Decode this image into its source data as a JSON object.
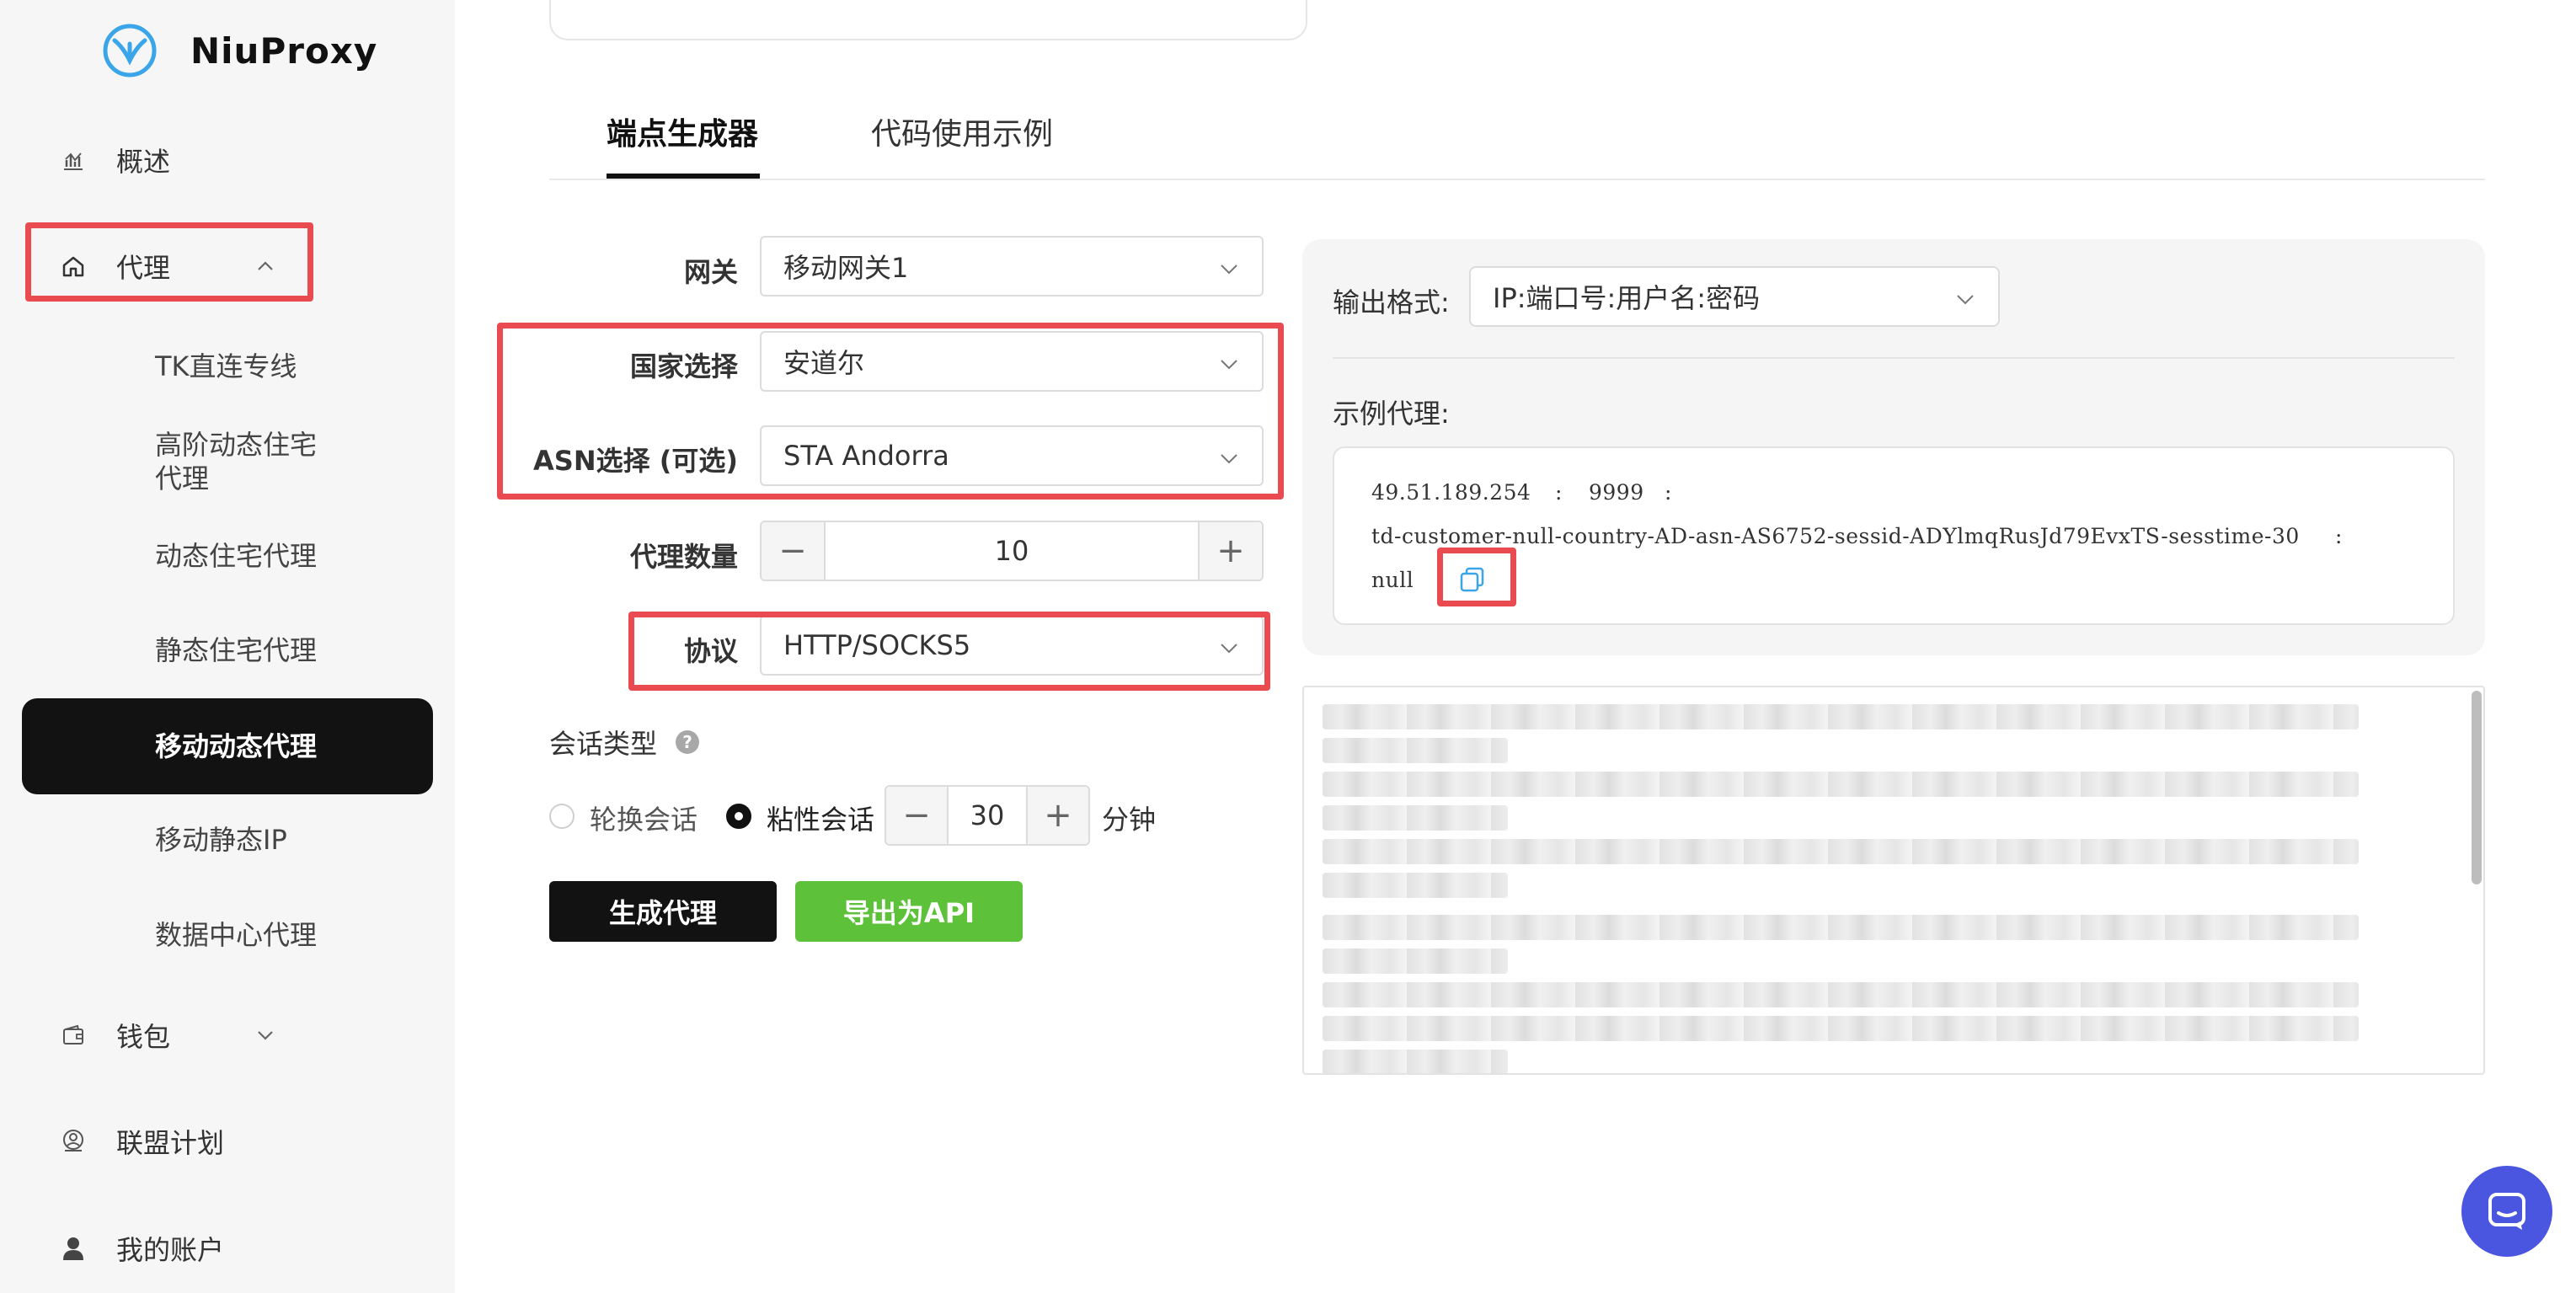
{
  "brand": {
    "name": "NiuProxy"
  },
  "sidebar": {
    "top_items": [
      {
        "label": "概述",
        "icon": "chart-icon"
      },
      {
        "label": "代理",
        "icon": "home-icon"
      },
      {
        "label": "钱包",
        "icon": "wallet-icon"
      },
      {
        "label": "联盟计划",
        "icon": "affiliate-icon"
      },
      {
        "label": "我的账户",
        "icon": "user-icon"
      }
    ],
    "sub_items": [
      {
        "label": "TK直连专线"
      },
      {
        "label": "高阶动态住宅\n代理"
      },
      {
        "label": "动态住宅代理"
      },
      {
        "label": "静态住宅代理"
      },
      {
        "label": "移动动态代理",
        "active": true
      },
      {
        "label": "移动静态IP"
      },
      {
        "label": "数据中心代理"
      }
    ]
  },
  "tabs": [
    {
      "label": "端点生成器",
      "active": true
    },
    {
      "label": "代码使用示例",
      "active": false
    }
  ],
  "form": {
    "gateway": {
      "label": "网关",
      "value": "移动网关1"
    },
    "country": {
      "label": "国家选择",
      "value": "安道尔"
    },
    "asn": {
      "label": "ASN选择 (可选)",
      "value": "STA Andorra"
    },
    "quantity": {
      "label": "代理数量",
      "value": "10",
      "minus": "−",
      "plus": "+"
    },
    "protocol": {
      "label": "协议",
      "value": "HTTP/SOCKS5"
    }
  },
  "session": {
    "title": "会话类型",
    "help": "?",
    "rotating_label": "轮换会话",
    "sticky_label": "粘性会话",
    "selected": "sticky",
    "duration": "30",
    "minus": "−",
    "plus": "+",
    "unit": "分钟"
  },
  "buttons": {
    "generate": "生成代理",
    "export_api": "导出为API"
  },
  "output": {
    "format_label": "输出格式:",
    "format_value": "IP:端口号:用户名:密码",
    "example_label": "示例代理:",
    "example_ip": "49.51.189.254",
    "example_sep": ":",
    "example_port": "9999",
    "example_user": "td-customer-null-country-AD-asn-AS6752-sessid-ADYlmqRusJd79EvxTS-sesstime-30",
    "example_pass": "null"
  },
  "colors": {
    "highlight": "#e94b50",
    "primary": "#121212",
    "green": "#5ec13a",
    "chat": "#4a55e0"
  }
}
